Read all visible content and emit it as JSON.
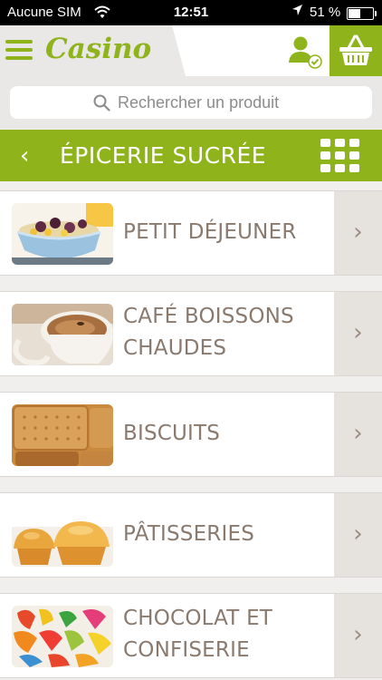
{
  "status_bar": {
    "carrier": "Aucune SIM",
    "time": "12:51",
    "battery_pct_label": "51 %",
    "battery_level": 0.51
  },
  "header": {
    "logo_text": "Casino",
    "brand_color": "#8fb31a",
    "icons": [
      "menu-icon",
      "user-icon",
      "basket-icon"
    ]
  },
  "search": {
    "placeholder": "Rechercher un produit"
  },
  "category_bar": {
    "back_glyph": "‹",
    "title": "ÉPICERIE SUCRÉE"
  },
  "categories": [
    {
      "label_lines": [
        "PETIT DÉJEUNER"
      ],
      "image": "breakfast-bowl"
    },
    {
      "label_lines": [
        "CAFÉ BOISSONS",
        "CHAUDES"
      ],
      "image": "coffee-cup"
    },
    {
      "label_lines": [
        "BISCUITS"
      ],
      "image": "biscuits"
    },
    {
      "label_lines": [
        "PÂTISSERIES"
      ],
      "image": "muffins"
    },
    {
      "label_lines": [
        "CHOCOLAT ET",
        "CONFISERIE"
      ],
      "image": "candies"
    }
  ],
  "row_arrow_glyph": "›"
}
